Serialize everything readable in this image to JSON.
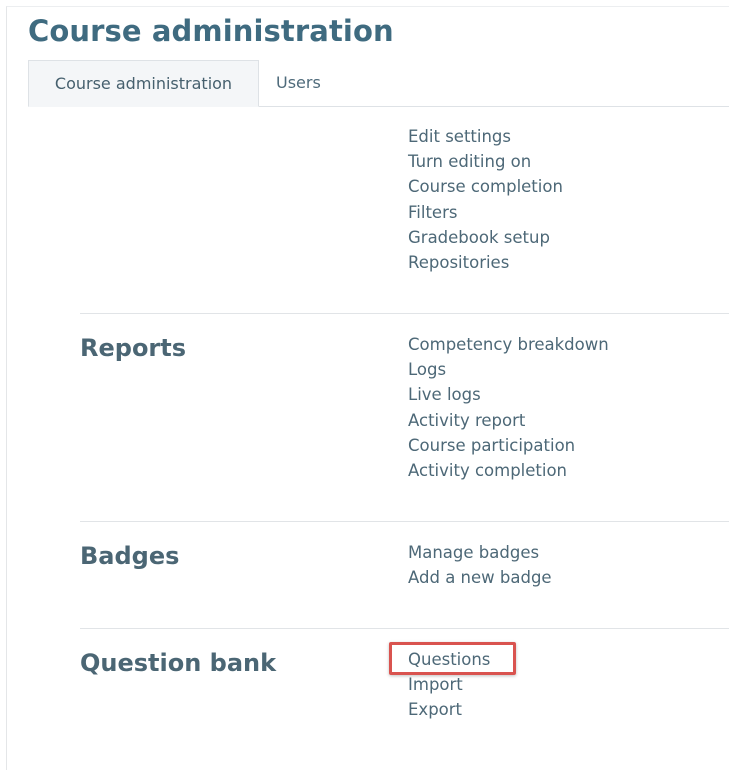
{
  "page": {
    "title": "Course administration"
  },
  "tabs": [
    {
      "label": "Course administration",
      "active": true
    },
    {
      "label": "Users",
      "active": false
    }
  ],
  "sections": [
    {
      "heading": "",
      "links": [
        "Edit settings",
        "Turn editing on",
        "Course completion",
        "Filters",
        "Gradebook setup",
        "Repositories"
      ]
    },
    {
      "heading": "Reports",
      "links": [
        "Competency breakdown",
        "Logs",
        "Live logs",
        "Activity report",
        "Course participation",
        "Activity completion"
      ]
    },
    {
      "heading": "Badges",
      "links": [
        "Manage badges",
        "Add a new badge"
      ]
    },
    {
      "heading": "Question bank",
      "links": [
        "Questions",
        "Import",
        "Export"
      ]
    }
  ],
  "colors": {
    "title": "#3f6b80",
    "link": "#4d6877",
    "highlight": "#d9534f",
    "active_tab_bg": "#f4f6f8"
  }
}
